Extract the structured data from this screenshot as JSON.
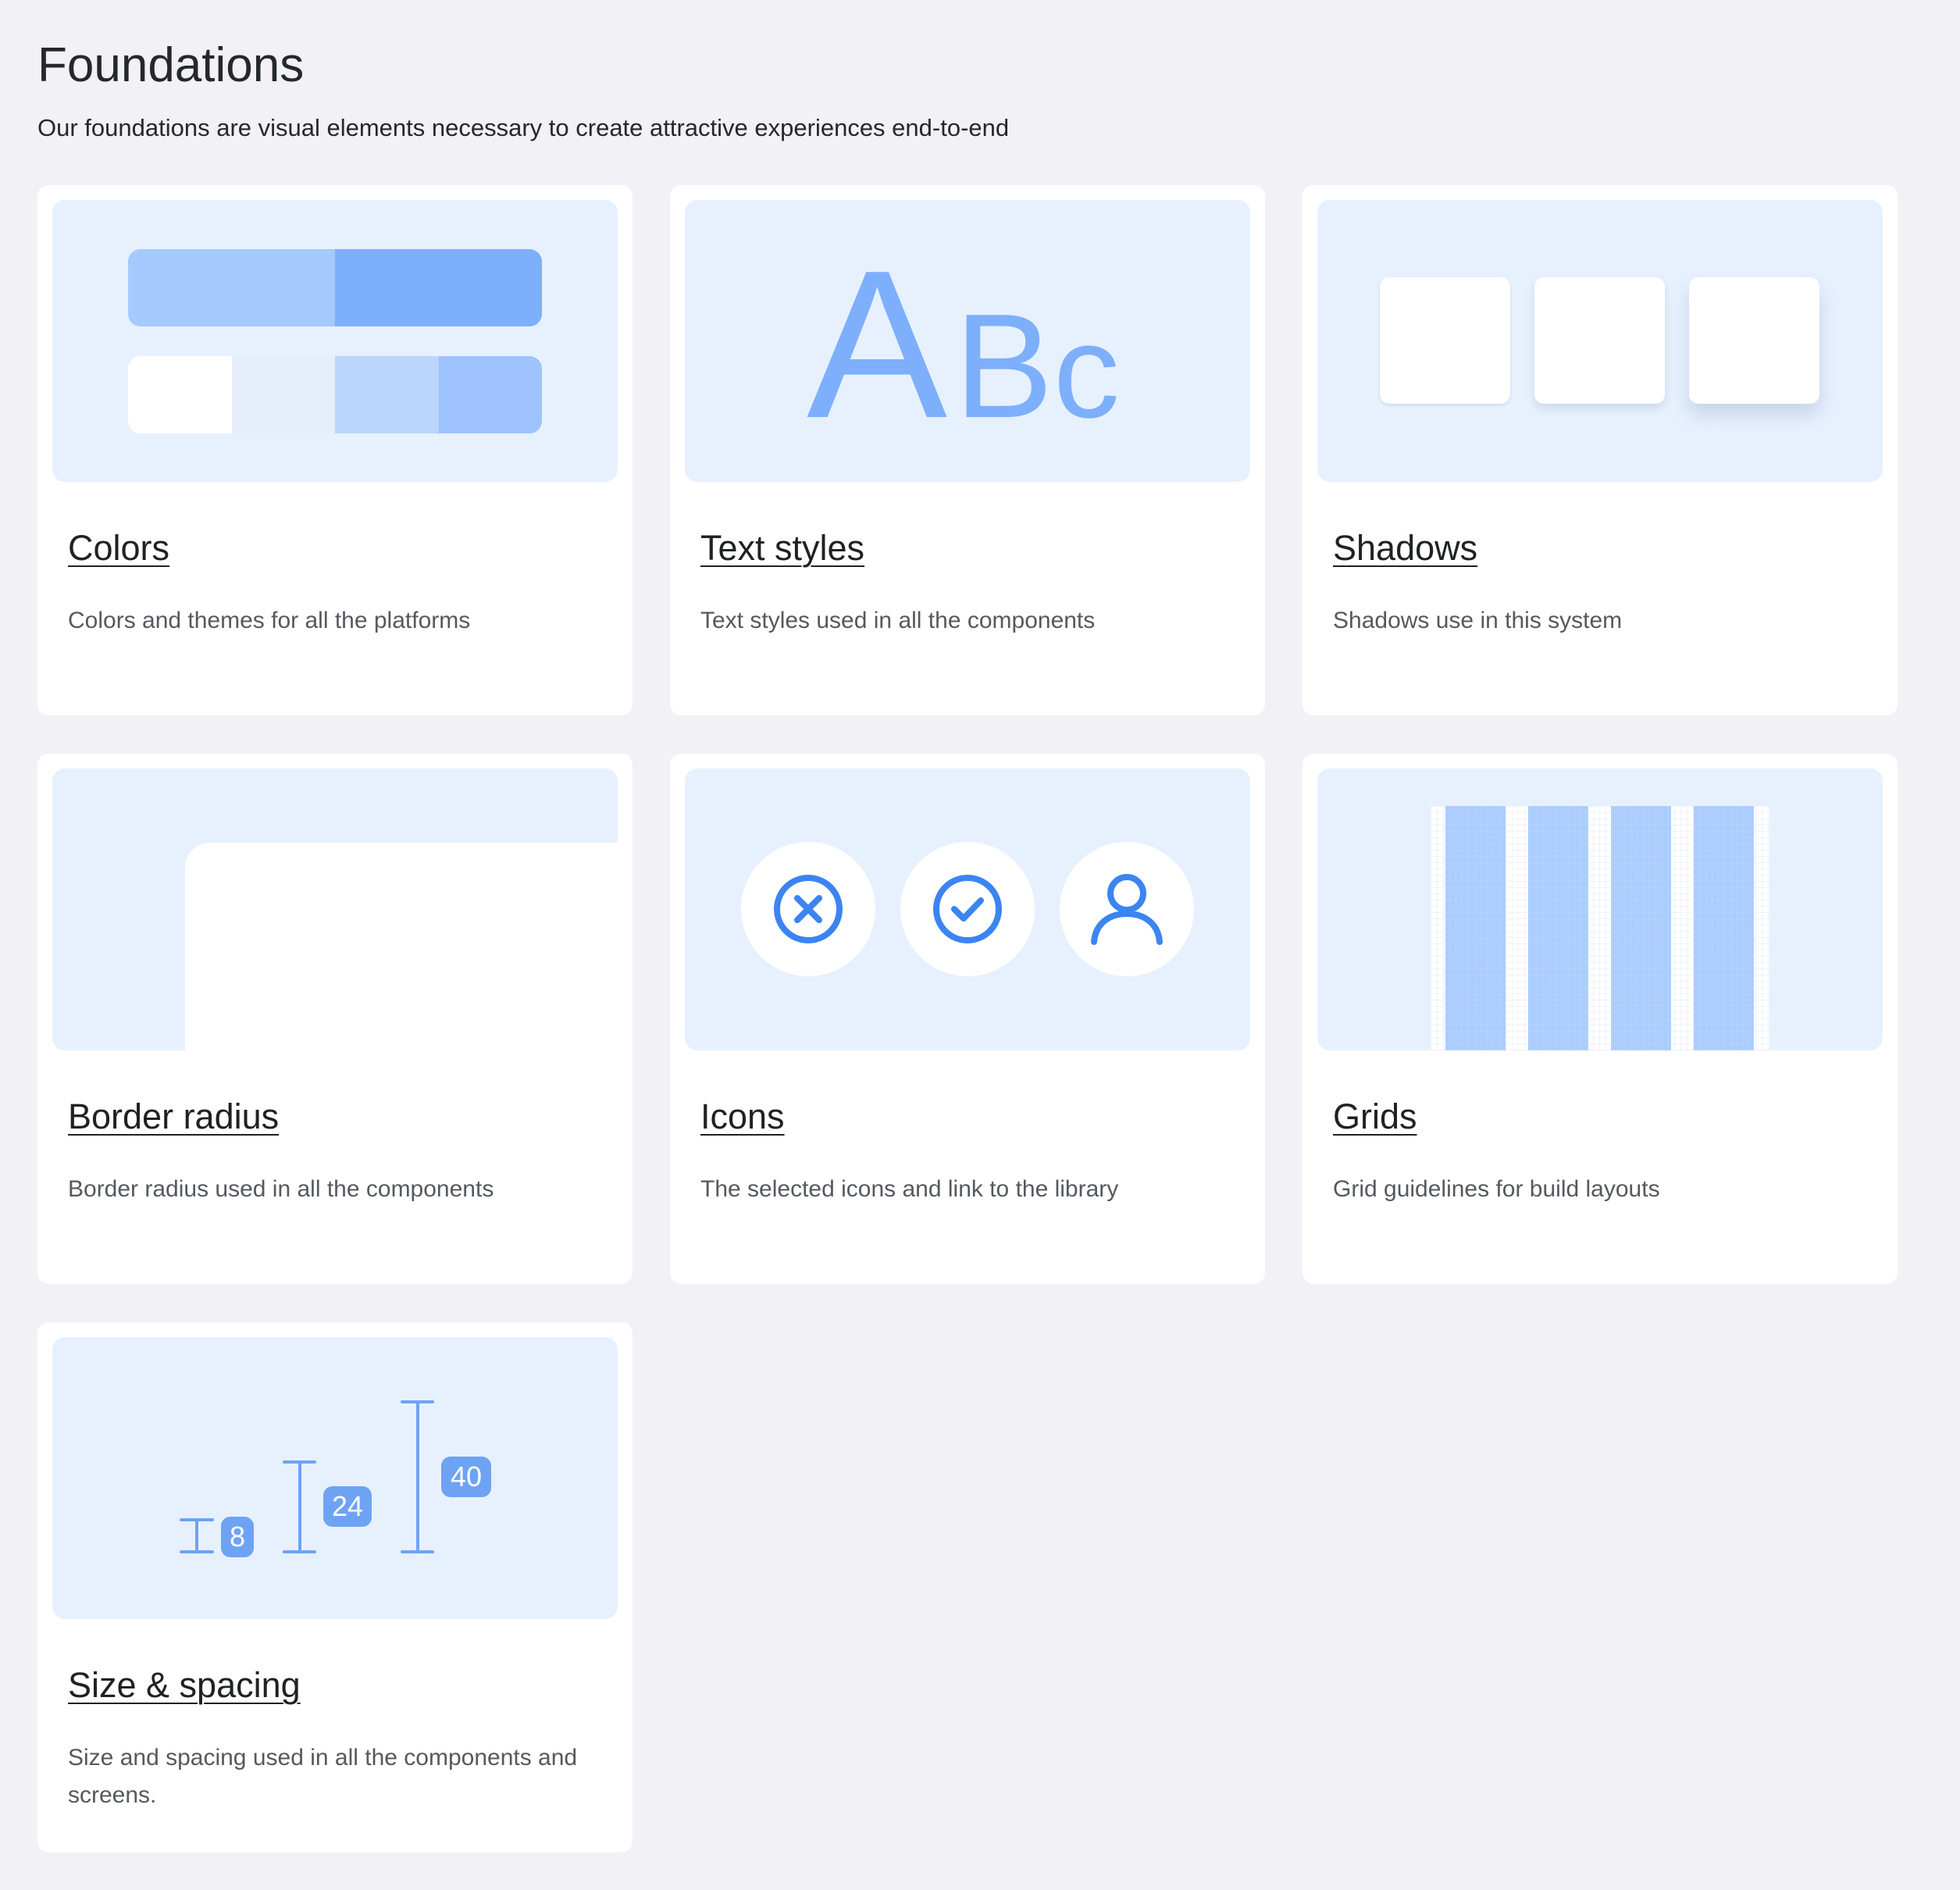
{
  "header": {
    "title": "Foundations",
    "subtitle": "Our foundations are visual elements necessary to create attractive experiences end-to-end"
  },
  "accent_colors": {
    "page_bg": "#f1f1f6",
    "card_bg": "#ffffff",
    "thumb_bg": "#e7f1fe",
    "accent": "#3c84f0",
    "accent_light": "#7eaffd"
  },
  "cards": [
    {
      "title": "Colors",
      "desc": "Colors and themes for all the platforms",
      "thumb": "color-swatches"
    },
    {
      "title": "Text styles",
      "desc": "Text styles used in all the components",
      "thumb": "abc-glyphs",
      "glyphs": [
        "A",
        "B",
        "c"
      ]
    },
    {
      "title": "Shadows",
      "desc": "Shadows use in this system",
      "thumb": "shadow-squares"
    },
    {
      "title": "Border radius",
      "desc": "Border radius used in all the components",
      "thumb": "rounded-corner"
    },
    {
      "title": "Icons",
      "desc": "The selected icons and link to the library",
      "thumb": "icon-samples",
      "icons": [
        "close-circle-icon",
        "check-circle-icon",
        "user-icon"
      ]
    },
    {
      "title": "Grids",
      "desc": "Grid guidelines for build layouts",
      "thumb": "grid-columns"
    },
    {
      "title": "Size & spacing",
      "desc": "Size and spacing used in all the components and screens.",
      "thumb": "spacing-markers",
      "sizes": [
        "8",
        "24",
        "40"
      ]
    }
  ]
}
